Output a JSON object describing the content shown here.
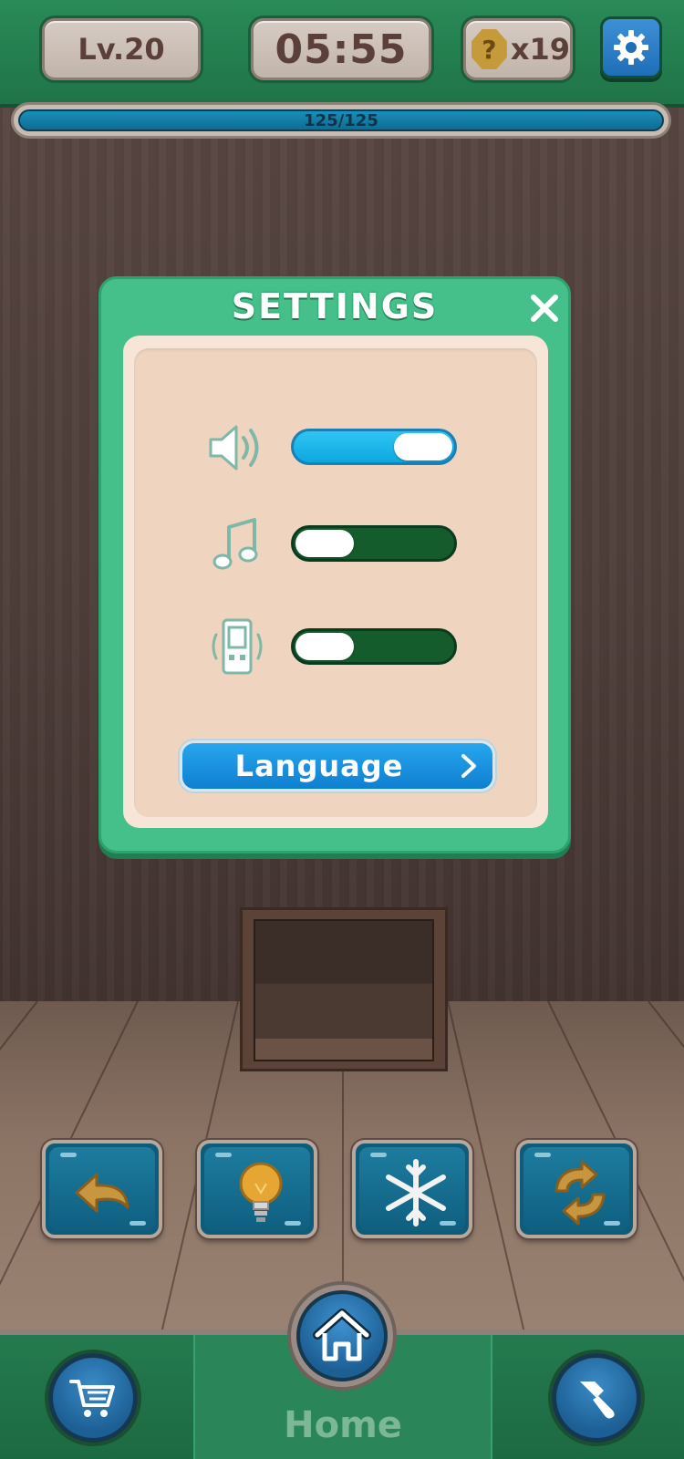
{
  "hud": {
    "level": "Lv.20",
    "timer": "05:55",
    "hint_coin_symbol": "?",
    "hint_count": "x19",
    "settings_icon": "gear-icon"
  },
  "progress": {
    "label": "125/125",
    "current": 125,
    "total": 125
  },
  "settings_modal": {
    "title": "SETTINGS",
    "close_icon": "close-icon",
    "toggles": [
      {
        "icon": "speaker-icon",
        "on": true
      },
      {
        "icon": "music-note-icon",
        "on": false
      },
      {
        "icon": "vibration-icon",
        "on": false
      }
    ],
    "language_button": "Language"
  },
  "tools": [
    {
      "icon": "undo-arrow-icon"
    },
    {
      "icon": "lightbulb-icon"
    },
    {
      "icon": "snowflake-icon"
    },
    {
      "icon": "shuffle-icon"
    }
  ],
  "bottom_nav": {
    "shop_icon": "cart-icon",
    "home_icon": "home-icon",
    "home_label": "Home",
    "decorate_icon": "paintbrush-icon"
  },
  "colors": {
    "hud_green": "#2a8a58",
    "modal_green": "#45c08a",
    "toggle_on": "#0ea8e0",
    "toggle_off": "#145c2c",
    "language_blue": "#1a93e0"
  }
}
